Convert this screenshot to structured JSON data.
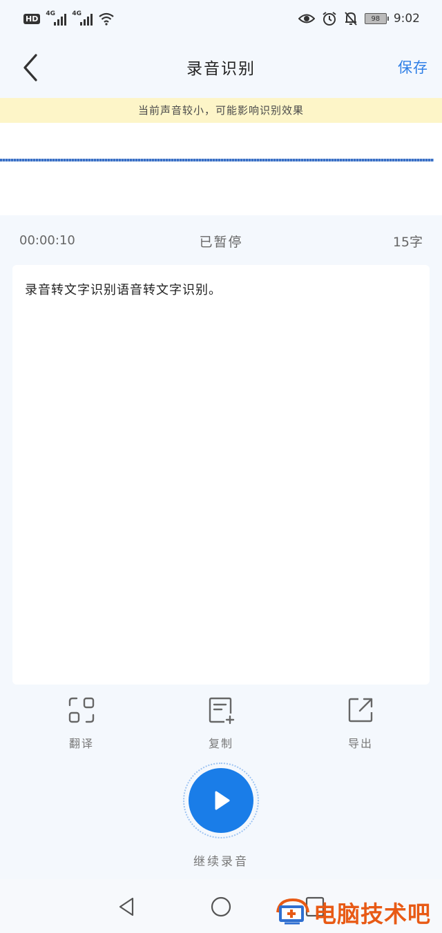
{
  "status_bar": {
    "hd_label": "HD",
    "signal1_tech": "4G",
    "signal2_tech": "4G",
    "battery_level": "98",
    "time": "9:02"
  },
  "header": {
    "title": "录音识别",
    "save_label": "保存"
  },
  "notice": {
    "text": "当前声音较小，可能影响识别效果"
  },
  "recording": {
    "elapsed": "00:00:10",
    "state": "已暂停",
    "char_count": "15字"
  },
  "transcript": {
    "text": "录音转文字识别语音转文字识别。"
  },
  "tools": [
    {
      "label": "翻译",
      "icon": "translate-icon"
    },
    {
      "label": "复制",
      "icon": "copy-icon"
    },
    {
      "label": "导出",
      "icon": "export-icon"
    }
  ],
  "resume": {
    "label": "继续录音"
  },
  "watermark": {
    "text": "电脑技术吧"
  },
  "colors": {
    "accent": "#1a7de8",
    "notice_bg": "#fdf5c8",
    "page_bg": "#f4f8fd",
    "watermark": "#e85a15"
  }
}
